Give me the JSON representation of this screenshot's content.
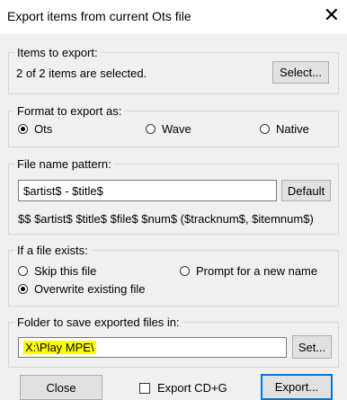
{
  "window": {
    "title": "Export items from current Ots file",
    "close_glyph": "✕"
  },
  "items_group": {
    "legend": "Items to export:",
    "status": "2 of 2 items are selected.",
    "select_button": "Select..."
  },
  "format_group": {
    "legend": "Format to export as:",
    "options": [
      {
        "label": "Ots",
        "checked": true
      },
      {
        "label": "Wave",
        "checked": false
      },
      {
        "label": "Native",
        "checked": false
      }
    ]
  },
  "filename_group": {
    "legend": "File name pattern:",
    "pattern_value": "$artist$ - $title$",
    "default_button": "Default",
    "tokens_hint": "$$ $artist$ $title$ $file$ $num$ ($tracknum$, $itemnum$)"
  },
  "exists_group": {
    "legend": "If a file exists:",
    "options": [
      {
        "label": "Skip this file",
        "checked": false
      },
      {
        "label": "Prompt for a new name",
        "checked": false
      },
      {
        "label": "Overwrite existing file",
        "checked": true
      }
    ]
  },
  "folder_group": {
    "legend": "Folder to save exported files in:",
    "folder_value": "X:\\Play MPE\\",
    "set_button": "Set...",
    "highlight_color": "#ffff00"
  },
  "footer": {
    "close_button": "Close",
    "export_cdg_label": "Export CD+G",
    "export_cdg_checked": false,
    "export_button": "Export..."
  }
}
